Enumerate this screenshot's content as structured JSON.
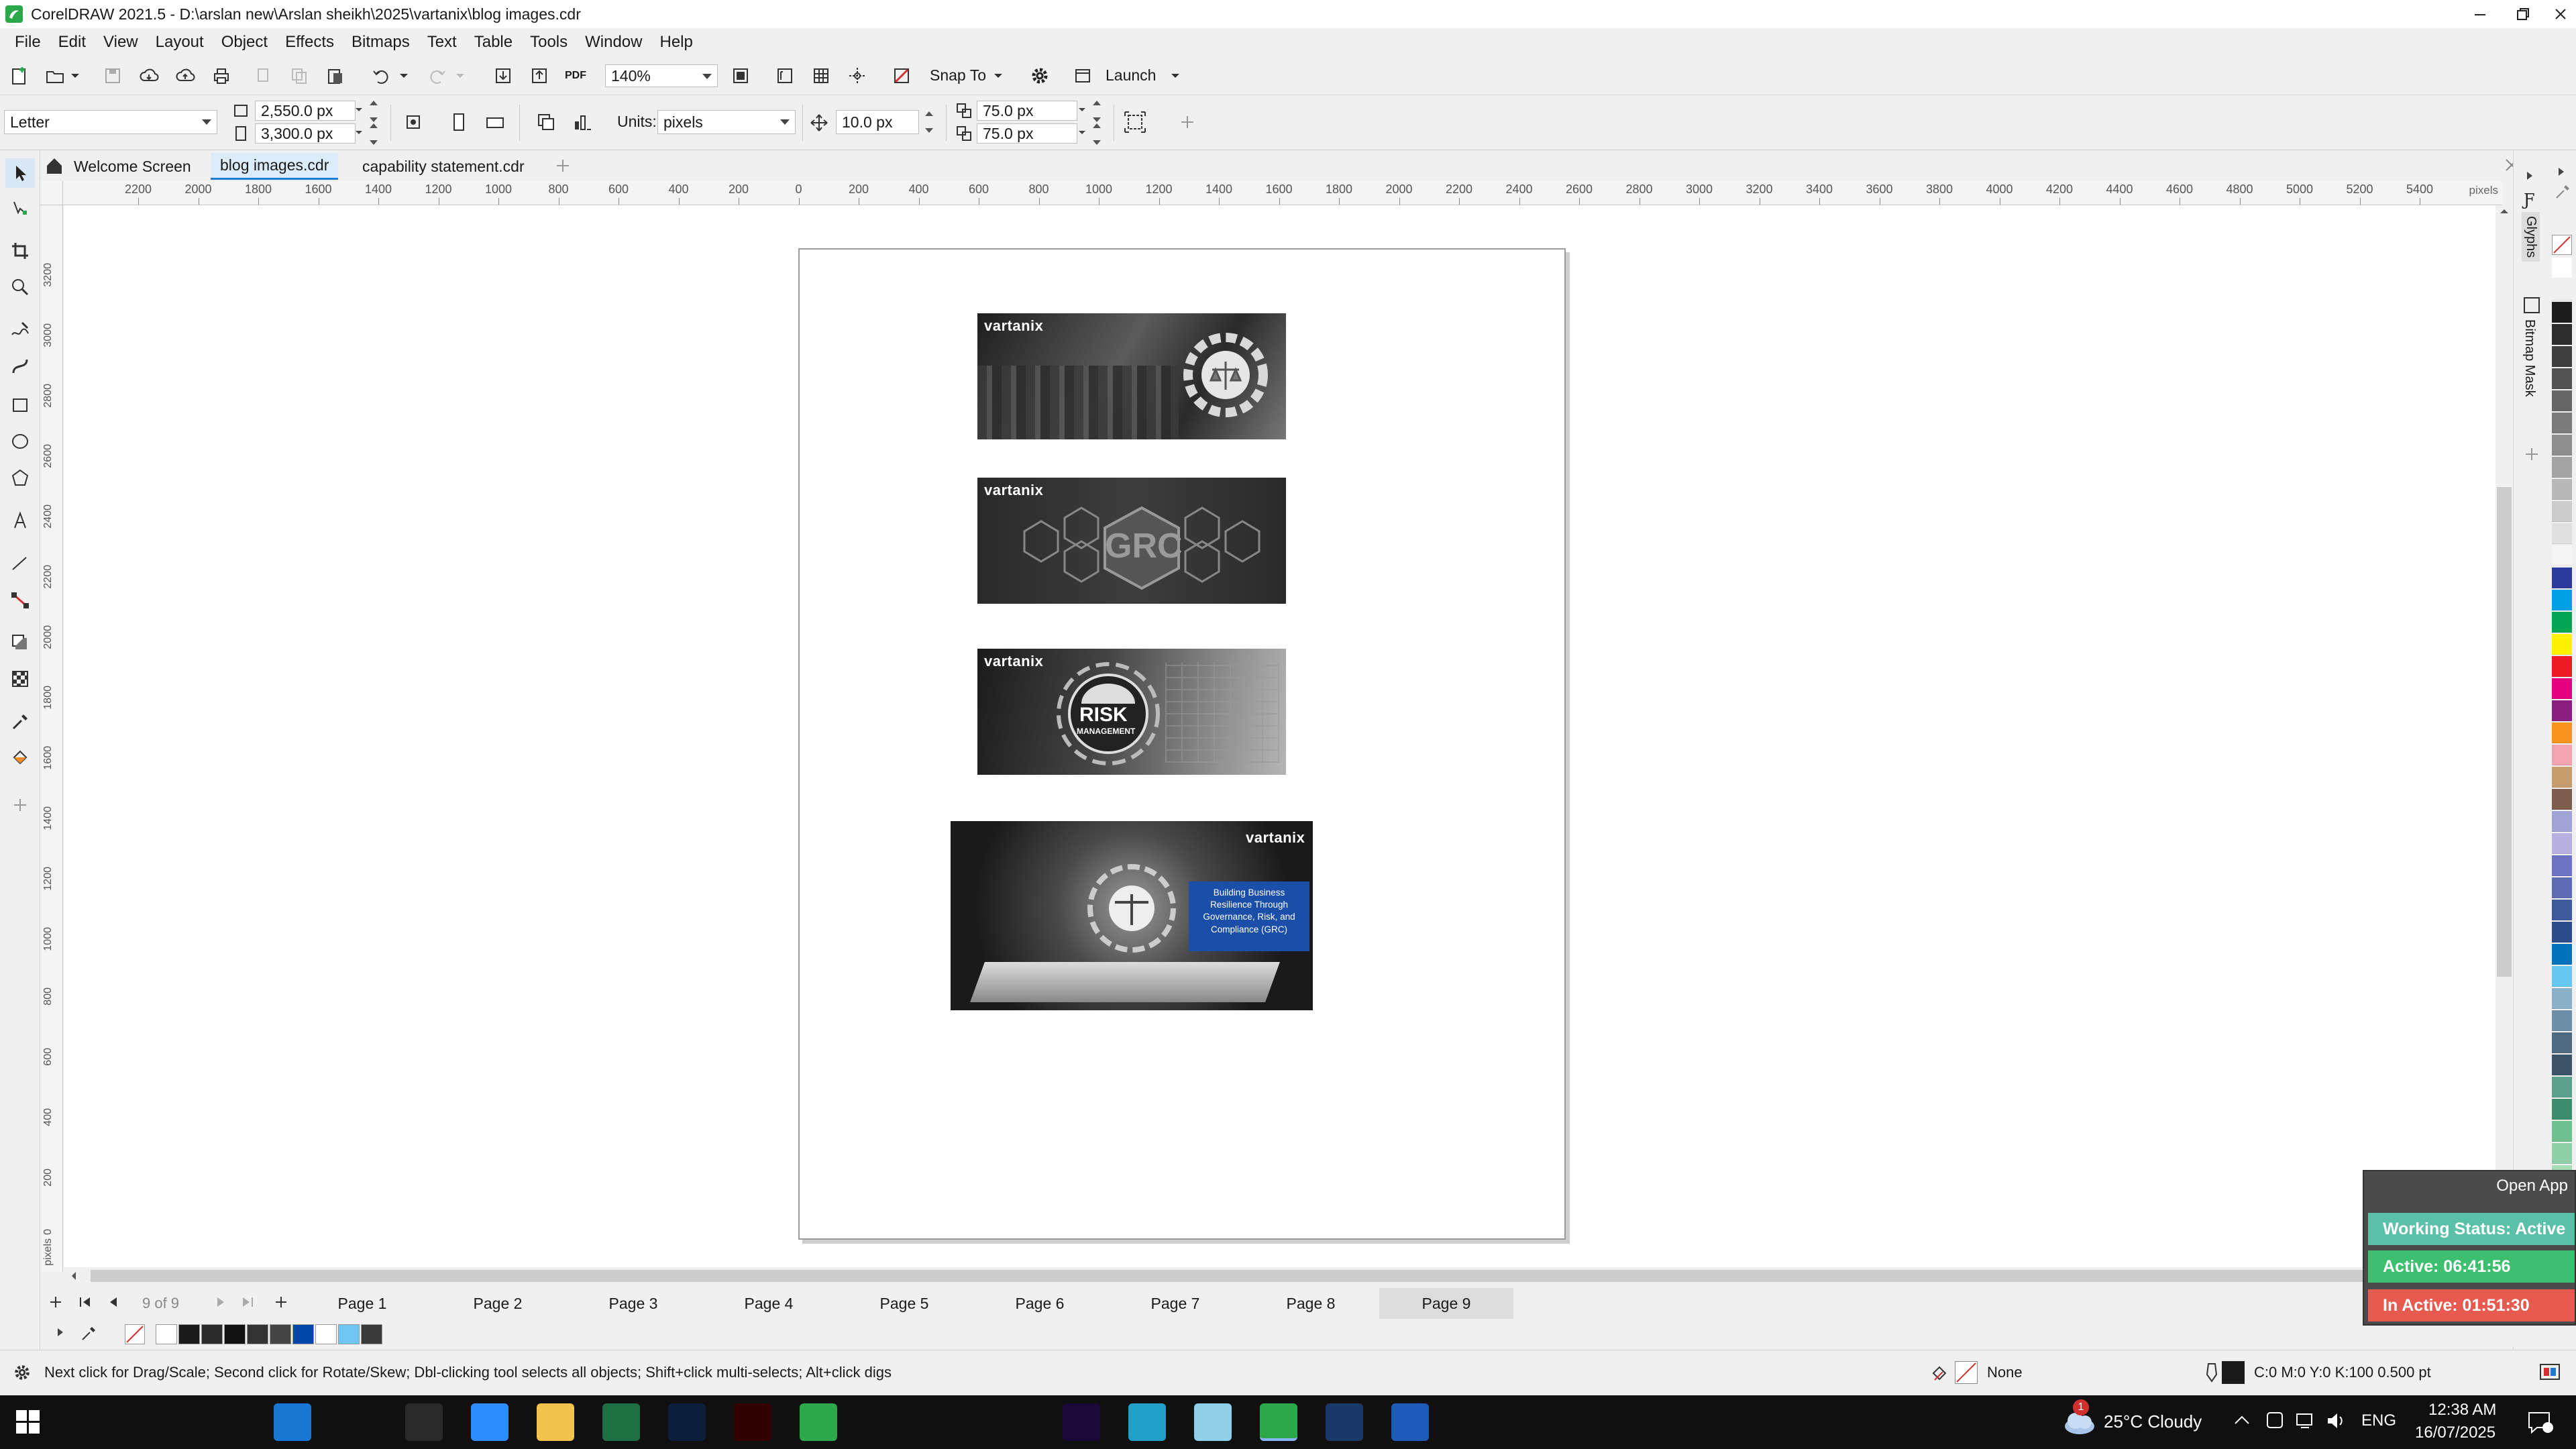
{
  "window": {
    "title": "CorelDRAW 2021.5 - D:\\arslan new\\Arslan sheikh\\2025\\vartanix\\blog images.cdr"
  },
  "menu": [
    "File",
    "Edit",
    "View",
    "Layout",
    "Object",
    "Effects",
    "Bitmaps",
    "Text",
    "Table",
    "Tools",
    "Window",
    "Help"
  ],
  "toolbar": {
    "zoom": "140%",
    "snap_label": "Snap To",
    "launch_label": "Launch",
    "pdf_label": "PDF"
  },
  "property_bar": {
    "page_size": "Letter",
    "width": "2,550.0 px",
    "height": "3,300.0 px",
    "units_label": "Units:",
    "units_value": "pixels",
    "nudge": "10.0 px",
    "dup_x": "75.0 px",
    "dup_y": "75.0 px"
  },
  "tabs": [
    "Welcome Screen",
    "blog images.cdr",
    "capability statement.cdr"
  ],
  "ruler": {
    "unit": "pixels",
    "top_labels": [
      "2200",
      "2000",
      "1800",
      "1600",
      "1400",
      "1200",
      "1000",
      "800",
      "600",
      "400",
      "200",
      "0",
      "200",
      "400",
      "600",
      "800",
      "1000",
      "1200",
      "1400",
      "1600",
      "1800",
      "2000",
      "2200",
      "2400",
      "2600",
      "2800",
      "3000",
      "3200",
      "3400",
      "3600",
      "3800",
      "4000",
      "4200",
      "4400",
      "4600",
      "4800",
      "5000",
      "5200",
      "5400"
    ],
    "left_labels": [
      "3200",
      "3000",
      "2800",
      "2600",
      "2400",
      "2200",
      "2000",
      "1800",
      "1600",
      "1400",
      "1200",
      "1000",
      "800",
      "600",
      "400",
      "200",
      "0"
    ],
    "left_unit": "pixels"
  },
  "images": [
    {
      "brand": "vartanix"
    },
    {
      "brand": "vartanix",
      "badge": "GRC"
    },
    {
      "brand": "vartanix",
      "badge": "RISK",
      "badge_sub": "MANAGEMENT"
    },
    {
      "brand": "vartanix",
      "caption": "Building Business Resilience Through Governance, Risk, and Compliance (GRC)"
    }
  ],
  "dockers": [
    "Glyphs",
    "Bitmap Mask"
  ],
  "palette": [
    "#ffffff",
    "#f0f0f0",
    "#1c1c1c",
    "#2d2d2d",
    "#3f3f3f",
    "#525252",
    "#666666",
    "#7a7a7a",
    "#8e8e8e",
    "#a3a3a3",
    "#b8b8b8",
    "#cccccc",
    "#e0e0e0",
    "#f5f5f5",
    "#2c3aa0",
    "#00a0e6",
    "#00a651",
    "#fff200",
    "#ed1c24",
    "#e6007e",
    "#8b1e7e",
    "#f7941d",
    "#f4a3b1",
    "#c69c6d",
    "#7c5c4a",
    "#9fa3d6",
    "#b7b0e0",
    "#6d72c3",
    "#5d6bb3",
    "#3e5a9b",
    "#2b4b8a",
    "#0072bc",
    "#64c8f0",
    "#8ab0c8",
    "#6c8ea6",
    "#4d6a80",
    "#3b5366",
    "#5aa08a",
    "#3c8c6e",
    "#6fbf8f",
    "#8fd0a8",
    "#a6dcb8",
    "#c0e8cc"
  ],
  "pages": {
    "counter": "9 of 9",
    "tabs": [
      "Page 1",
      "Page 2",
      "Page 3",
      "Page 4",
      "Page 5",
      "Page 6",
      "Page 7",
      "Page 8",
      "Page 9"
    ],
    "active": 8
  },
  "doc_palette": [
    "#ffffff",
    "#1a1a1a",
    "#2a2a2a",
    "#111111",
    "#333333",
    "#444444",
    "#0047ab",
    "#ffffff",
    "#6ec6f2",
    "#3a3a3a"
  ],
  "status": {
    "hint": "Next click for Drag/Scale; Second click for Rotate/Skew; Dbl-clicking tool selects all objects; Shift+click multi-selects; Alt+click digs",
    "fill": "None",
    "outline": "C:0 M:0 Y:0 K:100  0.500 pt"
  },
  "timer": {
    "open_app": "Open App",
    "working": "Working Status: Active",
    "active": "Active: 06:41:56",
    "inactive": "In Active: 01:51:30",
    "colors": {
      "working": "#5bc0a8",
      "active": "#3cbf6e",
      "inactive": "#e65a50"
    }
  },
  "taskbar": {
    "weather": "25°C  Cloudy",
    "lang": "ENG",
    "time": "12:38 AM",
    "date": "16/07/2025",
    "weather_badge": "1",
    "apps": [
      {
        "name": "search-app",
        "color": "#101010"
      },
      {
        "name": "cortana-app",
        "color": "#101010"
      },
      {
        "name": "taskview-app",
        "color": "#101010"
      },
      {
        "name": "edge-app",
        "color": "#1976d2"
      },
      {
        "name": "pen-app",
        "color": "#101010"
      },
      {
        "name": "terminal-app",
        "color": "#2a2a2a"
      },
      {
        "name": "zoom-app",
        "color": "#2d8cff"
      },
      {
        "name": "explorer-app",
        "color": "#f3c34c"
      },
      {
        "name": "excel-app",
        "color": "#1d7044"
      },
      {
        "name": "photoshop-app",
        "color": "#0b1e3a"
      },
      {
        "name": "illustrator-app",
        "color": "#330000"
      },
      {
        "name": "corel-app",
        "color": "#2aa84a"
      },
      {
        "name": "chrome-app",
        "color": "#101010"
      },
      {
        "name": "vscode-app",
        "color": "#101010"
      },
      {
        "name": "chrome2-app",
        "color": "#101010"
      },
      {
        "name": "premiere-app",
        "color": "#1a0a3a"
      },
      {
        "name": "unknown-app",
        "color": "#1ea0c8"
      },
      {
        "name": "unknown2-app",
        "color": "#8fd0e8"
      },
      {
        "name": "corel-active-app",
        "color": "#2aa84a"
      },
      {
        "name": "calculator-app",
        "color": "#1a3a6a"
      },
      {
        "name": "word-app",
        "color": "#1c5bb8"
      }
    ]
  }
}
